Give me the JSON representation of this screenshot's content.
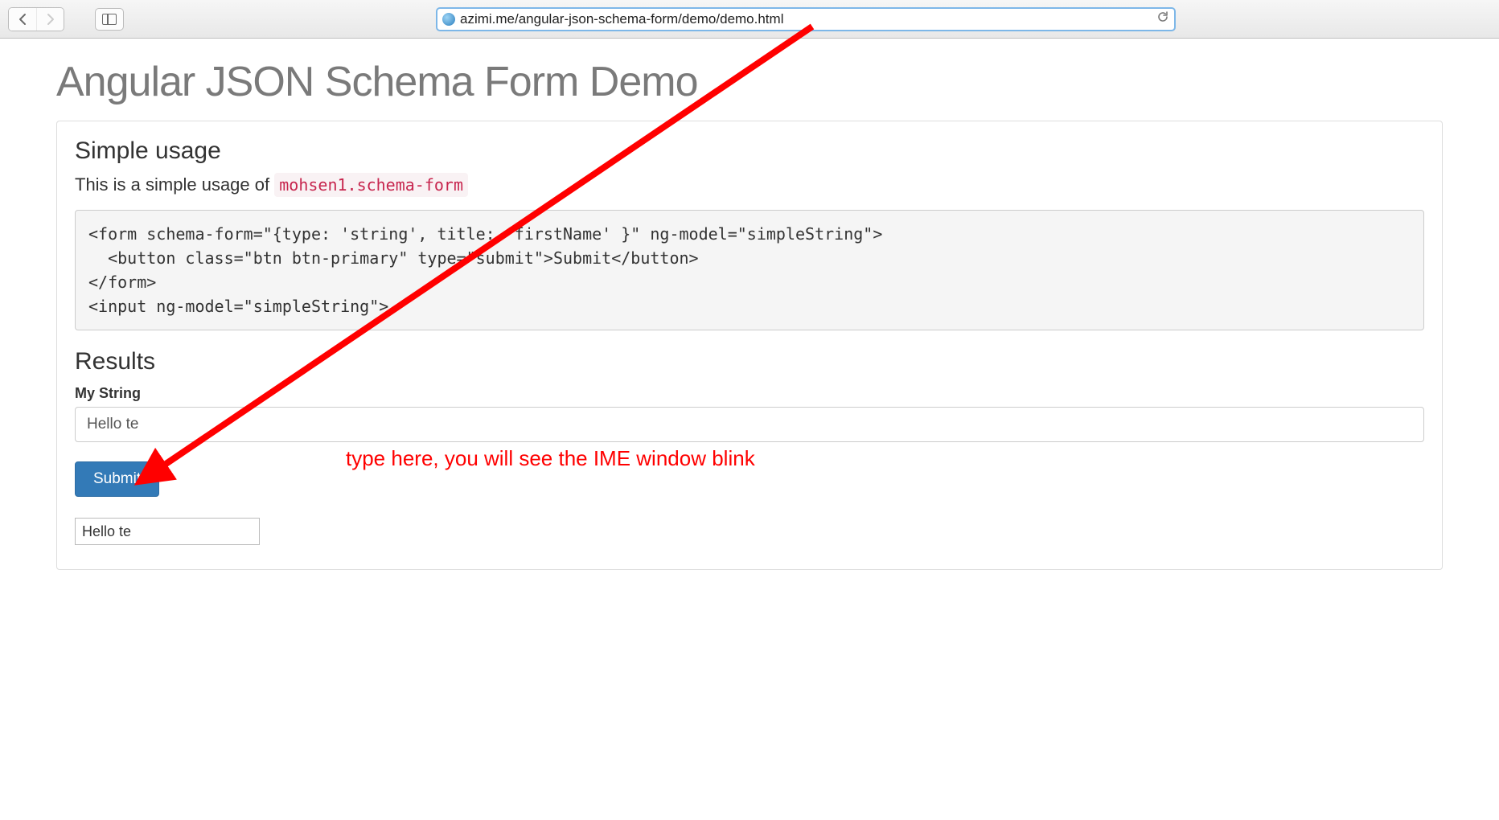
{
  "browser": {
    "url": "azimi.me/angular-json-schema-form/demo/demo.html"
  },
  "page": {
    "title": "Angular JSON Schema Form Demo",
    "section_simple": "Simple usage",
    "lead_prefix": "This is a simple usage of ",
    "lead_code": "mohsen1.schema-form",
    "code_block": "<form schema-form=\"{type: 'string', title: 'firstName' }\" ng-model=\"simpleString\">\n  <button class=\"btn btn-primary\" type=\"submit\">Submit</button>\n</form>\n<input ng-model=\"simpleString\">",
    "results_heading": "Results",
    "field_label": "My String",
    "field_value": "Hello te",
    "submit_label": "Submit",
    "mirror_input_value": "Hello te"
  },
  "annotation": {
    "text": "type here, you will see the IME window blink"
  }
}
